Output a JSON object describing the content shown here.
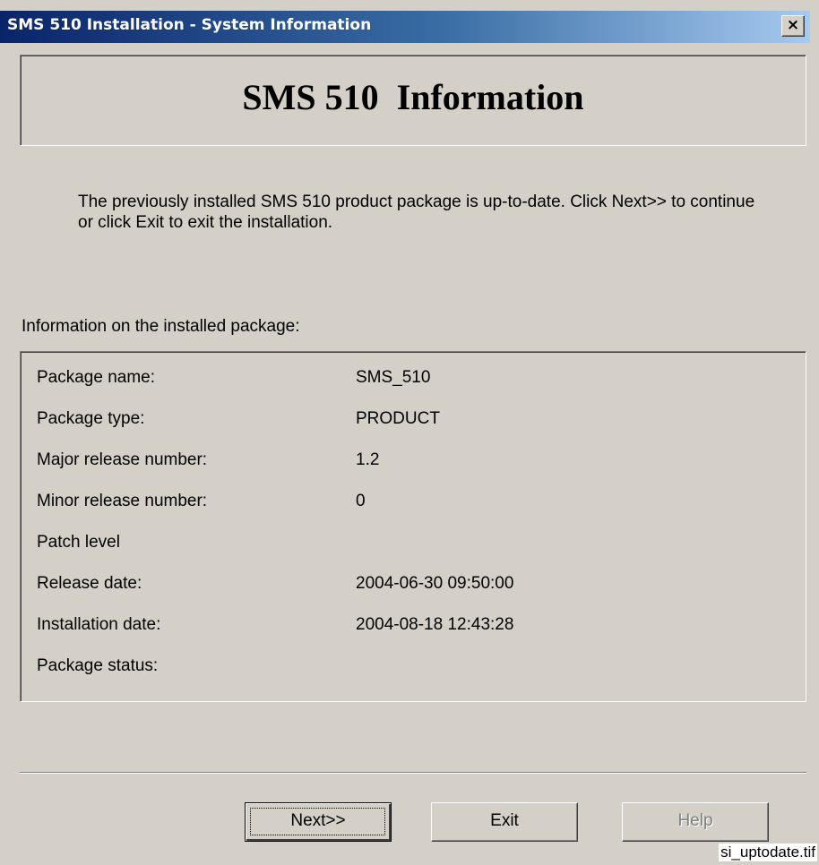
{
  "window": {
    "title": "SMS 510 Installation - System Information",
    "close_glyph": "×"
  },
  "header": {
    "title": "SMS 510  Information"
  },
  "intro": {
    "text": "The previously installed SMS 510 product package is up-to-date. Click Next>> to continue or click Exit to exit the installation."
  },
  "section": {
    "label": "Information on the installed package:"
  },
  "package_info": {
    "rows": [
      {
        "label": "Package name:",
        "value": "SMS_510"
      },
      {
        "label": "Package type:",
        "value": "PRODUCT"
      },
      {
        "label": "Major release number:",
        "value": "1.2"
      },
      {
        "label": "Minor release number:",
        "value": "0"
      },
      {
        "label": "Patch level",
        "value": ""
      },
      {
        "label": "Release date:",
        "value": "2004-06-30 09:50:00"
      },
      {
        "label": "Installation date:",
        "value": "2004-08-18 12:43:28"
      },
      {
        "label": "Package status:",
        "value": ""
      }
    ]
  },
  "buttons": {
    "next": {
      "label": "Next>>",
      "enabled": true
    },
    "exit": {
      "label": "Exit",
      "enabled": true
    },
    "help": {
      "label": "Help",
      "enabled": false
    }
  },
  "caption": "si_uptodate.tif",
  "colors": {
    "dialog_face": "#d4d0c8",
    "title_start": "#0a246a",
    "title_end": "#a6caf0",
    "disabled_text": "#808080"
  }
}
